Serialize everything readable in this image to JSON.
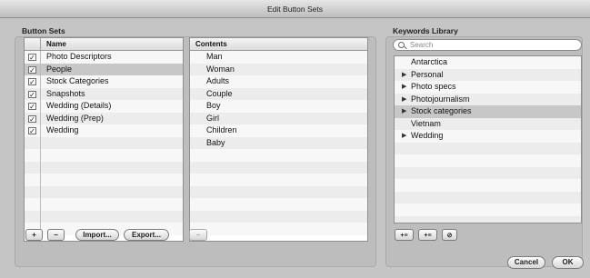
{
  "window": {
    "title": "Edit Button Sets"
  },
  "button_sets": {
    "section_label": "Button Sets",
    "column_header": "Name",
    "rows": [
      {
        "label": "Photo Descriptors",
        "checked": true,
        "selected": false
      },
      {
        "label": "People",
        "checked": true,
        "selected": true
      },
      {
        "label": "Stock Categories",
        "checked": true,
        "selected": false
      },
      {
        "label": "Snapshots",
        "checked": true,
        "selected": false
      },
      {
        "label": "Wedding (Details)",
        "checked": true,
        "selected": false
      },
      {
        "label": "Wedding (Prep)",
        "checked": true,
        "selected": false
      },
      {
        "label": "Wedding",
        "checked": true,
        "selected": false
      }
    ],
    "buttons": {
      "add": "+",
      "remove": "−",
      "import": "Import...",
      "export": "Export..."
    }
  },
  "contents": {
    "column_header": "Contents",
    "items": [
      "Man",
      "Woman",
      "Adults",
      "Couple",
      "Boy",
      "Girl",
      "Children",
      "Baby"
    ],
    "remove_button": "−"
  },
  "keywords_library": {
    "section_label": "Keywords Library",
    "search_placeholder": "Search",
    "items": [
      {
        "label": "Antarctica",
        "expandable": false,
        "selected": false
      },
      {
        "label": "Personal",
        "expandable": true,
        "selected": false
      },
      {
        "label": "Photo specs",
        "expandable": true,
        "selected": false
      },
      {
        "label": "Photojournalism",
        "expandable": true,
        "selected": false
      },
      {
        "label": "Stock categories",
        "expandable": true,
        "selected": true
      },
      {
        "label": "Vietnam",
        "expandable": false,
        "selected": false
      },
      {
        "label": "Wedding",
        "expandable": true,
        "selected": false
      }
    ],
    "expand_glyph": "▶",
    "check_glyph": "✓",
    "icons": [
      "add-keyword-icon",
      "add-subkeyword-icon",
      "remove-keyword-icon"
    ]
  },
  "dialog_buttons": {
    "cancel": "Cancel",
    "ok": "OK"
  }
}
